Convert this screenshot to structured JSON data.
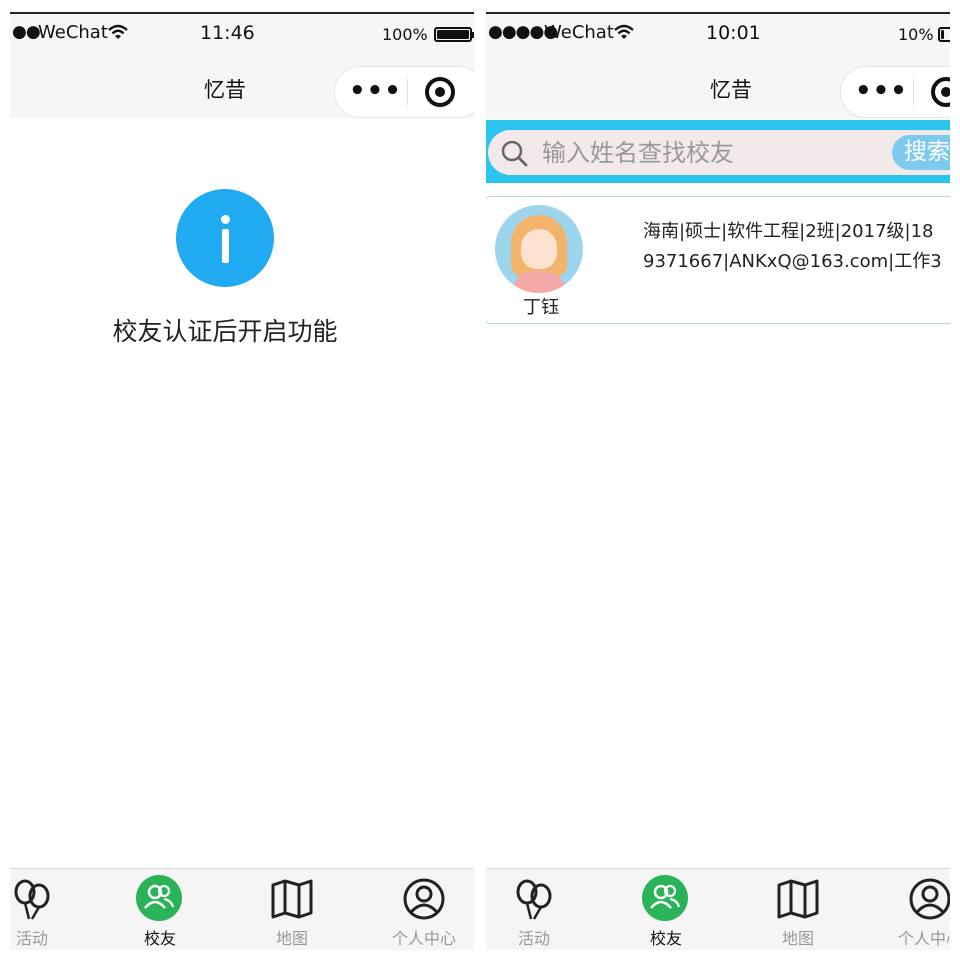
{
  "left": {
    "status": {
      "signal": "●●",
      "carrier": "WeChat",
      "time": "11:46",
      "battery": "100%",
      "battery_level": 1.0
    },
    "nav": {
      "title": "忆昔"
    },
    "gate_message": "校友认证后开启功能",
    "tabs": [
      {
        "label": "活动",
        "icon": "balloons-icon",
        "active": false
      },
      {
        "label": "校友",
        "icon": "alumni-icon",
        "active": true
      },
      {
        "label": "地图",
        "icon": "map-icon",
        "active": false
      },
      {
        "label": "个人中心",
        "icon": "user-circle-icon",
        "active": false
      }
    ]
  },
  "right": {
    "status": {
      "signal": "●●●●●",
      "carrier": "WeChat",
      "time": "10:01",
      "battery": "10%",
      "battery_level": 0.1
    },
    "nav": {
      "title": "忆昔"
    },
    "search": {
      "placeholder": "输入姓名查找校友",
      "button": "搜索"
    },
    "alumni": [
      {
        "name": "丁钰",
        "line1": "海南|硕士|软件工程|2班|2017级|18",
        "line2": "9371667|ANKxQ@163.com|工作3"
      }
    ],
    "tabs": [
      {
        "label": "活动",
        "icon": "balloons-icon",
        "active": false
      },
      {
        "label": "校友",
        "icon": "alumni-icon",
        "active": true
      },
      {
        "label": "地图",
        "icon": "map-icon",
        "active": false
      },
      {
        "label": "个人中心",
        "icon": "user-circle-icon",
        "active": false
      }
    ]
  },
  "colors": {
    "accent_blue": "#2bc4ee",
    "info_blue": "#1faaf2",
    "active_green": "#2bb35a",
    "search_button": "#7ec9ee"
  }
}
